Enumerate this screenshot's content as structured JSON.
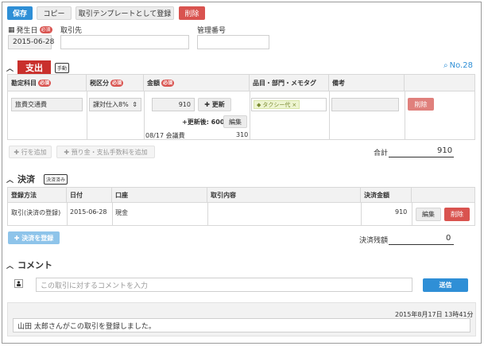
{
  "toolbar": {
    "save": "保存",
    "copy": "コピー",
    "template": "取引テンプレートとして登録",
    "delete": "削除"
  },
  "header": {
    "date_label": "発生日",
    "required": "必須",
    "date_value": "2015-06-28",
    "partner_label": "取引先",
    "partner_value": "",
    "mgmt_label": "管理番号",
    "mgmt_value": ""
  },
  "expense": {
    "title": "支出",
    "mode_tag": "手動",
    "number": "No.28",
    "columns": [
      "勘定科目",
      "税区分",
      "金額",
      "品目・部門・メモタグ",
      "備考"
    ],
    "row": {
      "account": "旅費交通費",
      "tax": "課対仕入8%",
      "amount": "910",
      "update_btn": "更新",
      "tag": "タクシー代",
      "delete": "削除",
      "after_update_label": "+更新後: 600",
      "edit": "編集",
      "sub_date": "08/17 会議費",
      "sub_amount": "310"
    },
    "add_row": "行を追加",
    "add_deposit": "預り金・支払手数料を追加",
    "total_label": "合計",
    "total_value": "910"
  },
  "settlement": {
    "title": "決済",
    "status_tag": "決済済み",
    "columns": [
      "登録方法",
      "日付",
      "口座",
      "取引内容",
      "決済金額"
    ],
    "row": {
      "method": "取引(決済の登録)",
      "date": "2015-06-28",
      "account": "現金",
      "content": "",
      "amount": "910",
      "edit": "編集",
      "delete": "削除"
    },
    "register_btn": "決済を登録",
    "balance_label": "決済残額",
    "balance_value": "0"
  },
  "comment": {
    "title": "コメント",
    "placeholder": "この取引に対するコメントを入力",
    "send": "送信",
    "log_time": "2015年8月17日 13時41分",
    "log_text": "山田 太郎さんがこの取引を登録しました。"
  },
  "colors": {
    "accent": "#2f8fd6",
    "danger": "#d9534f",
    "expense_red": "#c9302c"
  }
}
